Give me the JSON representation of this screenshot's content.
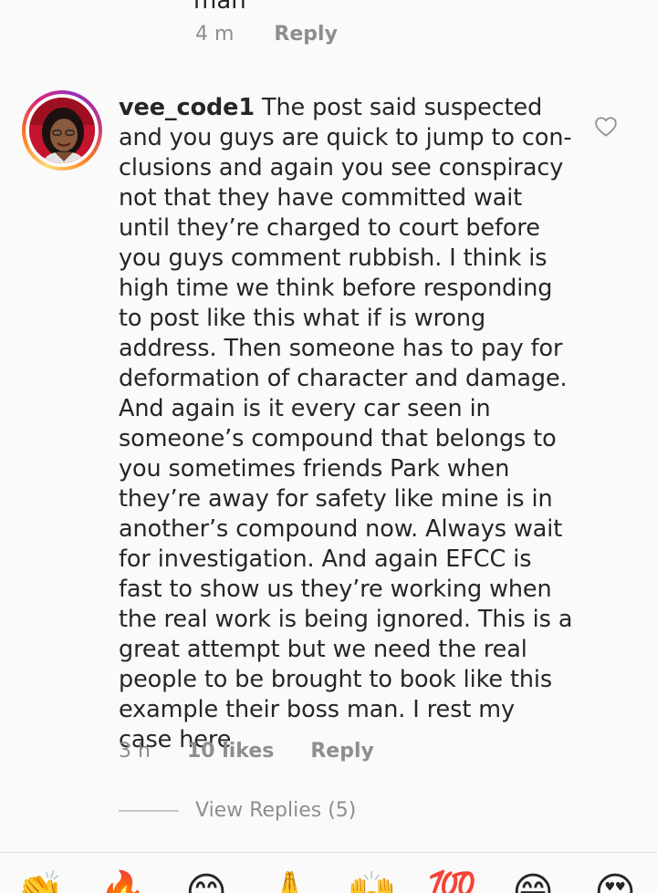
{
  "previous_comment": {
    "cut_text": "man",
    "time": "4 m",
    "reply_label": "Reply"
  },
  "comment": {
    "username": "vee_code1",
    "text": "The post said suspected and you guys are quick to jump to con-clusions and again you see conspiracy not that they have committed wait until they’re charged to court before you guys comment rubbish. I think is high time we think before responding to post like this what if is wrong address. Then someone has to pay for deformation of character and damage. And again is it every car seen in someone’s compound that belongs to you sometimes friends Park when they’re away for safety like mine is in another’s compound now. Always wait for investigation. And again EFCC is fast to show us they’re working when the real work is being ignored. This is a great attempt but we need the real people to be brought to book like this example their boss man. I rest my case here",
    "time": "3 h",
    "likes": "10 likes",
    "reply_label": "Reply",
    "view_replies": "View Replies (5)"
  },
  "icons": {
    "heart": "heart-outline-icon",
    "avatar": "user-avatar"
  },
  "emoji_bar": [
    {
      "name": "clapping-hands-emoji",
      "glyph": "👏"
    },
    {
      "name": "fire-emoji",
      "glyph": "🔥"
    },
    {
      "name": "smiling-face-emoji",
      "glyph": "😊"
    },
    {
      "name": "folded-hands-emoji",
      "glyph": "🙏"
    },
    {
      "name": "raising-hands-emoji",
      "glyph": "🙌"
    },
    {
      "name": "hundred-points-emoji",
      "glyph": "💯"
    },
    {
      "name": "grinning-face-emoji",
      "glyph": "😁"
    },
    {
      "name": "heart-eyes-emoji",
      "glyph": "😍"
    }
  ],
  "colors": {
    "text": "#262626",
    "muted": "#8e8e8e",
    "background": "#fafafa"
  }
}
